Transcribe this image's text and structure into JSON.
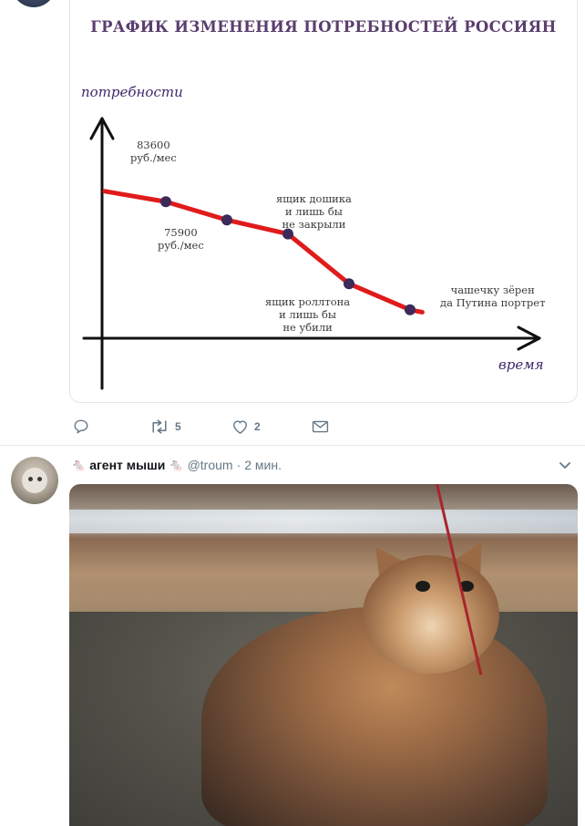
{
  "chart_data": {
    "type": "line",
    "title": "ГРАФИК ИЗМЕНЕНИЯ ПОТРЕБНОСТЕЙ РОССИЯН",
    "ylabel": "потребности",
    "xlabel": "время",
    "line_color": "#e01b1b",
    "marker_color": "#3d2a5a",
    "axis_color": "#111111",
    "points": [
      {
        "x": 0,
        "y": 88,
        "marker": false
      },
      {
        "x": 1,
        "y": 83.6,
        "marker": true
      },
      {
        "x": 2,
        "y": 75.9,
        "marker": true
      },
      {
        "x": 3,
        "y": 70,
        "marker": true
      },
      {
        "x": 4,
        "y": 49,
        "marker": true
      },
      {
        "x": 5,
        "y": 38,
        "marker": true
      },
      {
        "x": 5.2,
        "y": 37,
        "marker": false
      }
    ],
    "annotations": [
      {
        "text": "83600\nруб./мес"
      },
      {
        "text": "75900\nруб./мес"
      },
      {
        "text": "ящик дошика\nи лишь бы\nне закрыли"
      },
      {
        "text": "ящик роллтона\nи лишь бы\nне убили"
      },
      {
        "text": "чашечку зёрен\nда Путина портрет"
      }
    ]
  },
  "actions": {
    "reply_icon": "reply-icon",
    "retweet_icon": "retweet-icon",
    "retweet_count": "5",
    "like_icon": "heart-icon",
    "like_count": "2",
    "dm_icon": "envelope-icon"
  },
  "tweet": {
    "name_emoji_left": "🐁",
    "display_name": "агент мыши",
    "name_emoji_right": "🐁",
    "handle": "@troum",
    "separator": "·",
    "time": "2 мин.",
    "menu_icon": "chevron-down-icon"
  },
  "colors": {
    "icon_gray": "#657786",
    "divider": "#e6ecf0"
  }
}
